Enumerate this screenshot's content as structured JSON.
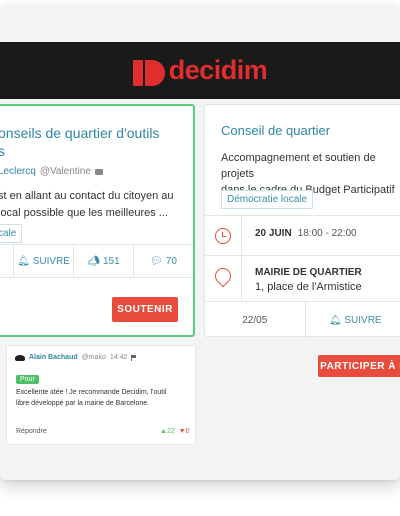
{
  "brand": {
    "name": "decidim",
    "color": "#e02d2d"
  },
  "proposal": {
    "title_lines": [
      "onseils de quartier d'outils",
      "s"
    ],
    "author": "Leclercq",
    "handle": "@Valentine",
    "text_lines": [
      "st en allant au contact du citoyen au",
      "local possible que les meilleures ..."
    ],
    "tag": "cale",
    "follow_label": "SUIVRE",
    "endorsements": "151",
    "comments": "70",
    "support_button": "SOUTENIR"
  },
  "meeting": {
    "title": "Conseil de quartier",
    "description_lines": [
      "Accompagnement et soutien de projets",
      "dans le cadre du Budget Participatif"
    ],
    "tag": "Démocratie locale",
    "date": "20 JUIN",
    "time": "18:00 - 22:00",
    "location_name": "MAIRIE DE QUARTIER",
    "location_address": "1, place de l'Armistice",
    "date_short": "22/05",
    "follow_label": "SUIVRE",
    "participate_button": "PARTICIPER À L"
  },
  "comment": {
    "author": "Alain Bachaud",
    "handle": "@mako",
    "time": "14:42",
    "badge": "Pour",
    "text_lines": [
      "Excellente idée ! Je recommande Decidim, l'outil",
      "libre développé par la mairie de Barcelone."
    ],
    "reply_label": "Répondre",
    "upvotes": "22",
    "downvotes": "0"
  },
  "colors": {
    "accent_blue": "#2f86a6",
    "green": "#57d079",
    "red": "#e74c3c",
    "header_bg": "#1a1a1a"
  }
}
